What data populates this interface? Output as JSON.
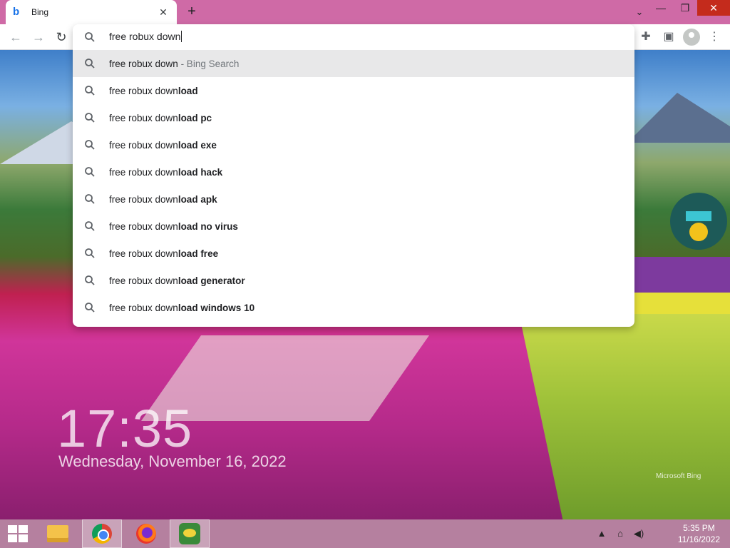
{
  "browser": {
    "tab_title": "Bing",
    "tab_favicon": "b",
    "close_tab": "✕",
    "new_tab": "+",
    "tab_menu": "⌄",
    "window_minimize": "—",
    "window_restore": "❐",
    "window_close": "✕",
    "back": "←",
    "forward": "→",
    "reload": "↻",
    "extensions": "✚",
    "sidepanel": "▣",
    "menu": "⋮"
  },
  "omnibox": {
    "input_value": "free robux down",
    "suggestions": [
      {
        "prefix": "free robux down",
        "bold": "",
        "suffix": " - Bing Search"
      },
      {
        "prefix": "free robux down",
        "bold": "load",
        "suffix": ""
      },
      {
        "prefix": "free robux down",
        "bold": "load pc",
        "suffix": ""
      },
      {
        "prefix": "free robux down",
        "bold": "load exe",
        "suffix": ""
      },
      {
        "prefix": "free robux down",
        "bold": "load hack",
        "suffix": ""
      },
      {
        "prefix": "free robux down",
        "bold": "load apk",
        "suffix": ""
      },
      {
        "prefix": "free robux down",
        "bold": "load no virus",
        "suffix": ""
      },
      {
        "prefix": "free robux down",
        "bold": "load free",
        "suffix": ""
      },
      {
        "prefix": "free robux down",
        "bold": "load generator",
        "suffix": ""
      },
      {
        "prefix": "free robux down",
        "bold": "load windows 10",
        "suffix": ""
      }
    ]
  },
  "wallpaper": {
    "clock": "17:35",
    "date": "Wednesday, November 16, 2022",
    "brand": "Microsoft Bing"
  },
  "taskbar": {
    "time": "5:35 PM",
    "date": "11/16/2022",
    "tray_chevron": "▲",
    "tray_network": "⌂",
    "tray_volume": "◀)"
  }
}
